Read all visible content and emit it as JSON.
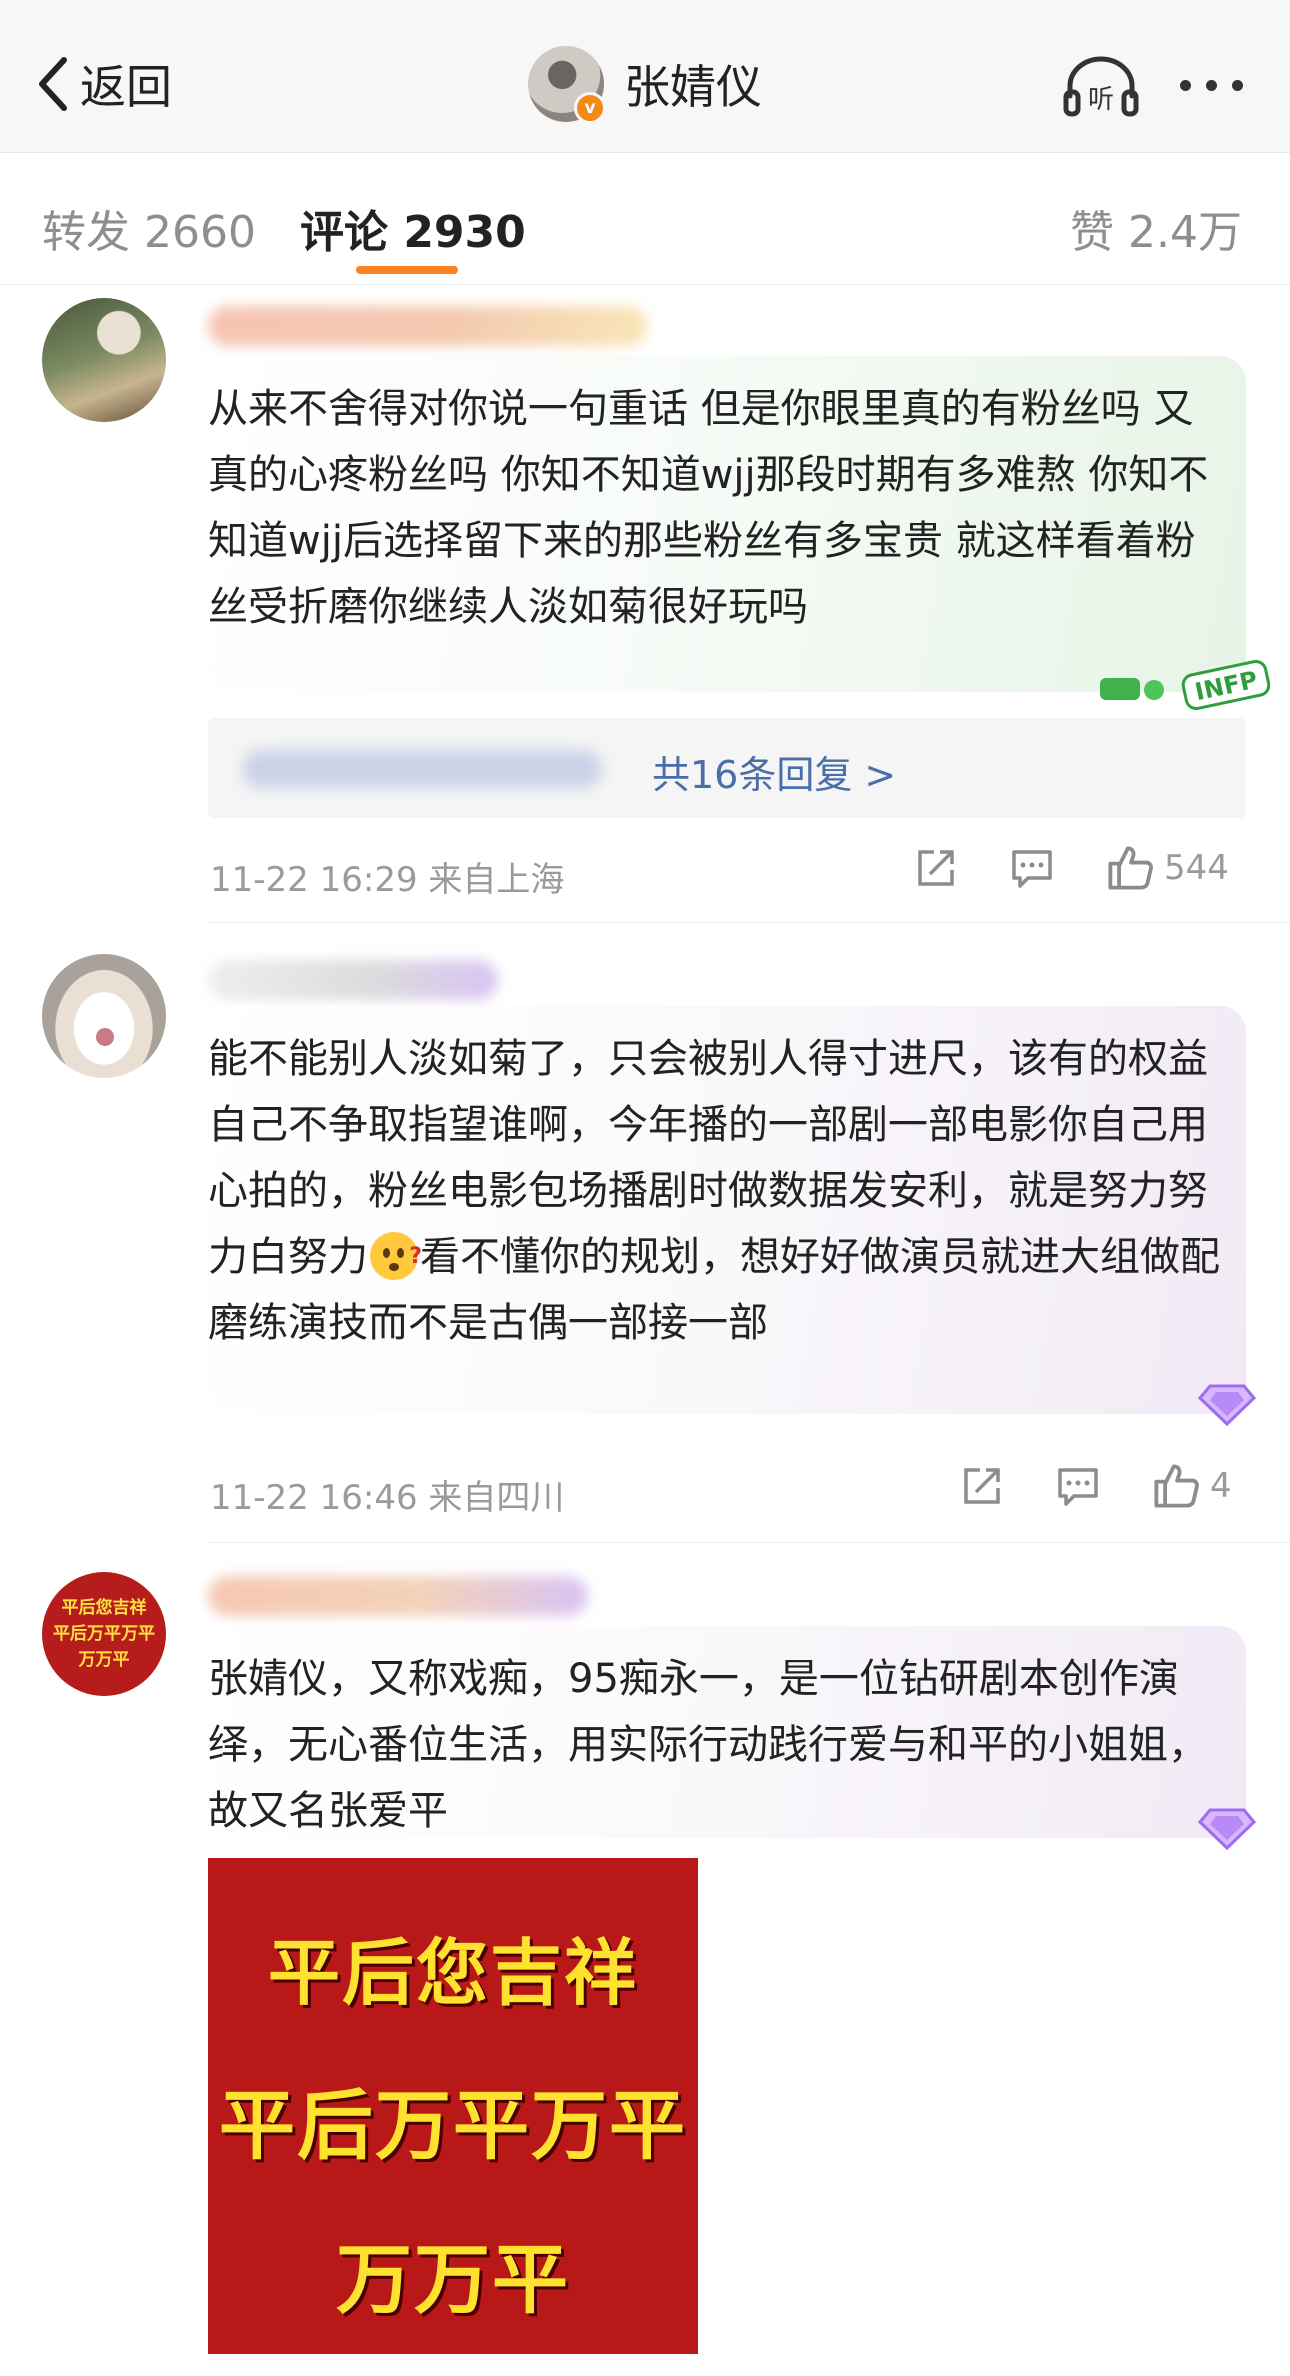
{
  "navbar": {
    "back_label": "返回",
    "title": "张婧仪",
    "verified_badge": "v",
    "listen_label": "听"
  },
  "tabs": {
    "repost": "转发 2660",
    "comment": "评论 2930",
    "likes": "赞 2.4万"
  },
  "comments": [
    {
      "text": "从来不舍得对你说一句重话 但是你眼里真的有粉丝吗 又真的心疼粉丝吗 你知不知道wjj那段时期有多难熬 你知不知道wjj后选择留下来的那些粉丝有多宝贵 就这样看着粉丝受折磨你继续人淡如菊很好玩吗",
      "sticker": "INFP",
      "reply_count": "共16条回复 >",
      "time_location": "11-22 16:29 来自上海",
      "likes": "544"
    },
    {
      "text_before_emoji": "能不能别人淡如菊了，只会被别人得寸进尺，该有的权益自己不争取指望谁啊，今年播的一部剧一部电影你自己用心拍的，粉丝电影包场播剧时做数据发安利，就是努力努力白努力",
      "emoji": "confused-face-emoji",
      "text_after_emoji": "看不懂你的规划，想好好做演员就进大组做配磨练演技而不是古偶一部接一部",
      "time_location": "11-22 16:46 来自四川",
      "likes": "4"
    },
    {
      "avatar_lines": [
        "平后您吉祥",
        "平后万平万平",
        "万万平"
      ],
      "text": "张婧仪，又称戏痴，95痴永一，是一位钻研剧本创作演绎，无心番位生活，用实际行动践行爱与和平的小姐姐，故又名张爱平",
      "image_lines": [
        "平后您吉祥",
        "平后万平万平",
        "万万平"
      ]
    }
  ],
  "colors": {
    "accent": "#fe8220",
    "link": "#4a6ea8",
    "meta": "#9a9a9a",
    "image_bg": "#b81817",
    "image_text": "#ffe22f"
  }
}
